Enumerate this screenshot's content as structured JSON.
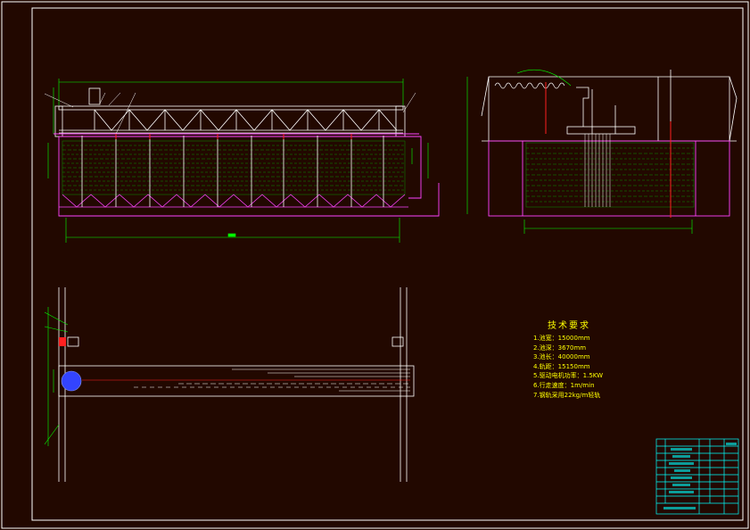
{
  "colors": {
    "background": "#220800",
    "frame": "#ffffff",
    "structure": "#ffffff",
    "truss": "#ffffff",
    "dimension": "#00ff00",
    "tank": "#ff44ff",
    "fill": "#00dd00",
    "accent_red": "#ff2020",
    "cyan": "#00ffff",
    "notes": "#ffff00",
    "blue_motor": "#3344ff"
  },
  "technical_requirements": {
    "title": "技术要求",
    "items": [
      "1.池宽：15000mm",
      "2.池深：3670mm",
      "3.池长：40000mm",
      "4.轨距：15150mm",
      "5.驱动电机功率：1.5KW",
      "6.行走速度：1m/min",
      "7.钢轨采用22kg/m轻轨"
    ]
  }
}
